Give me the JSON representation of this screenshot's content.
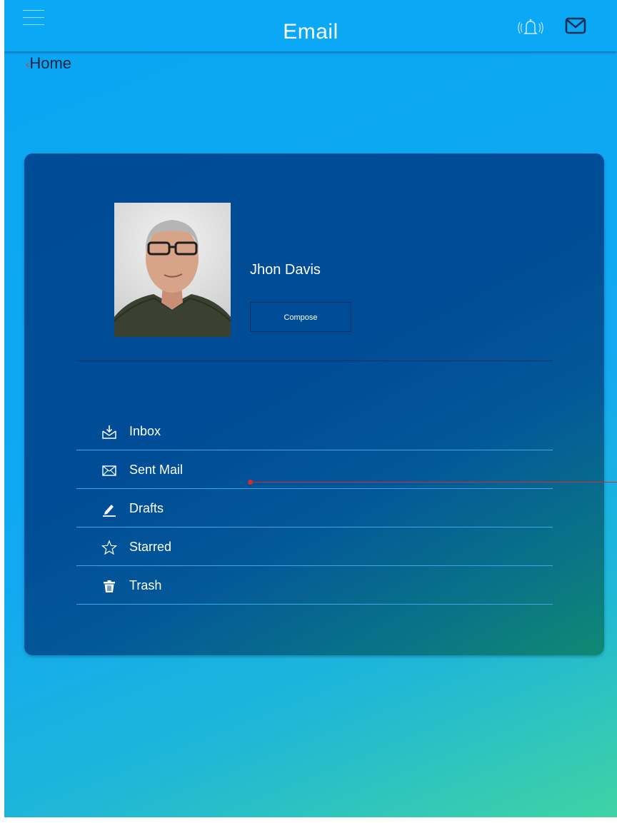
{
  "header": {
    "title": "Email",
    "menu_icon": "hamburger-icon",
    "notification_icon": "bell-icon",
    "mail_icon": "envelope-icon"
  },
  "breadcrumb": {
    "label": "Home",
    "icon": "chevron-left-icon"
  },
  "profile": {
    "name": "Jhon Davis",
    "compose_label": "Compose"
  },
  "nav": {
    "items": [
      {
        "label": "Inbox",
        "icon": "inbox-icon"
      },
      {
        "label": "Sent Mail",
        "icon": "envelope-icon"
      },
      {
        "label": "Drafts",
        "icon": "pencil-icon"
      },
      {
        "label": "Starred",
        "icon": "star-icon"
      },
      {
        "label": "Trash",
        "icon": "trash-icon"
      }
    ]
  },
  "colors": {
    "accent": "#0aa8f5",
    "card": "#004b95",
    "annotation_arrow": "#d92b2b"
  }
}
